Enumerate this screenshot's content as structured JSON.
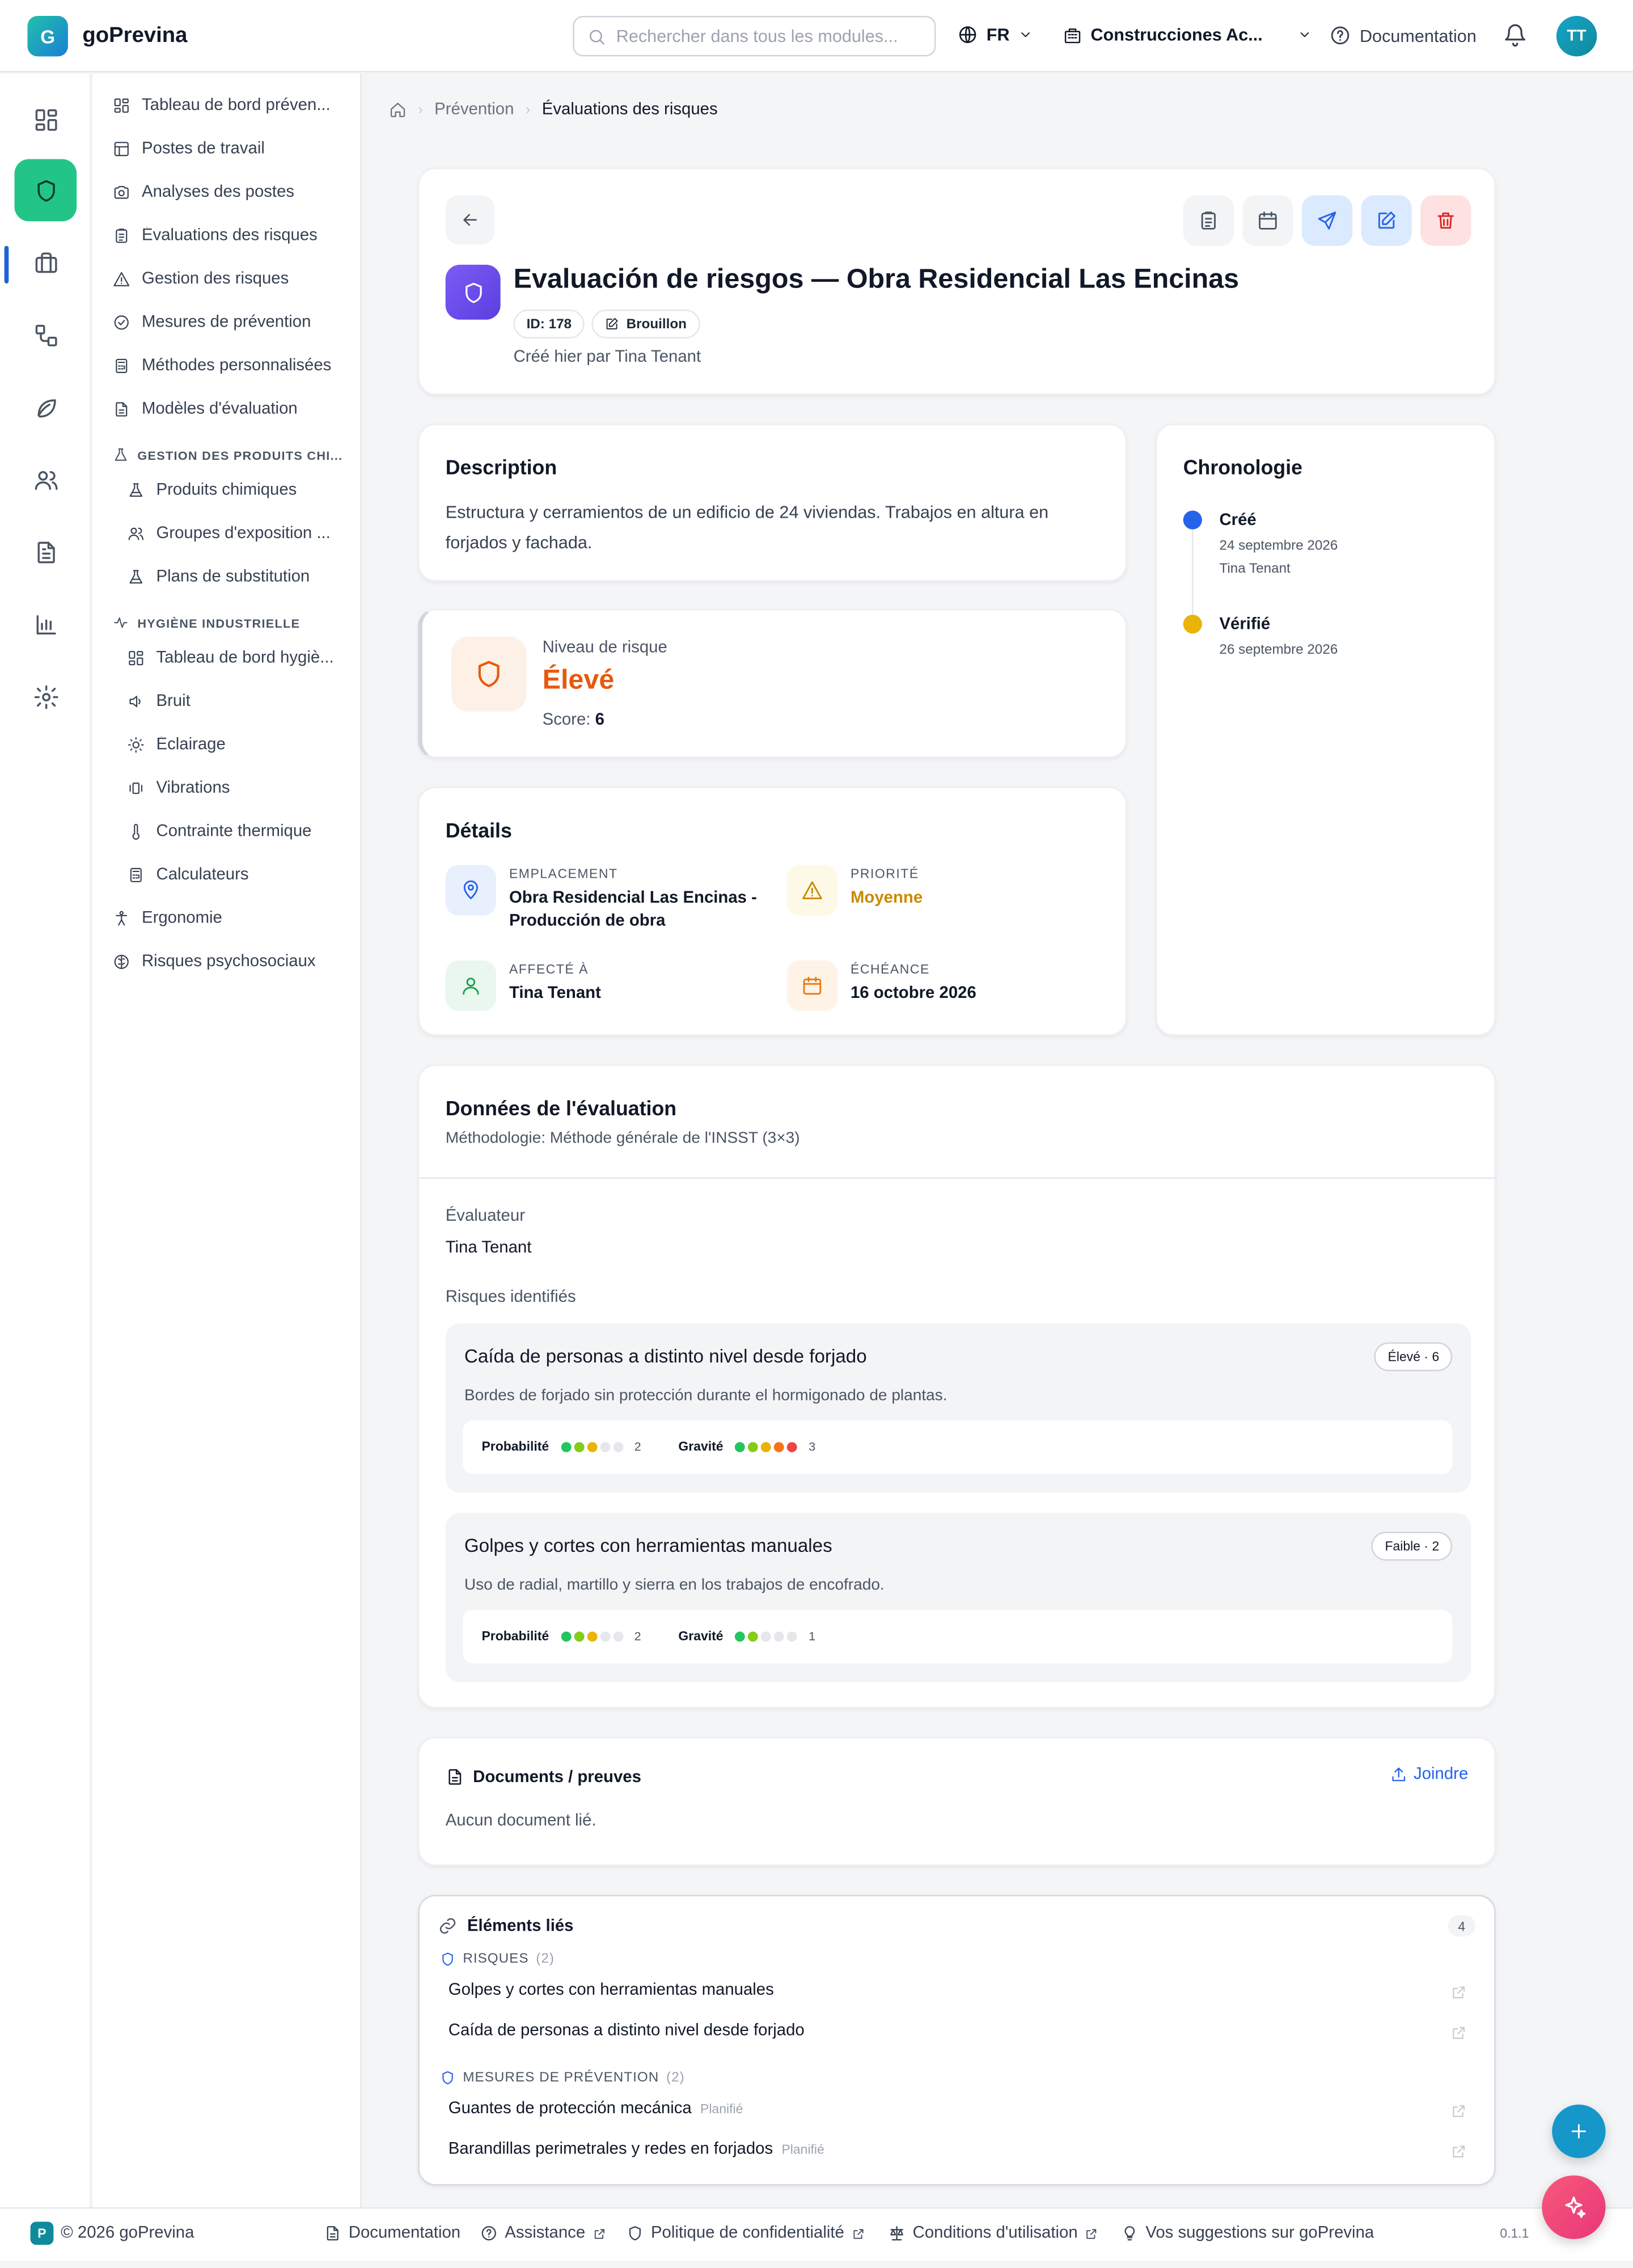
{
  "app": {
    "logo_letter": "G",
    "name": "goPrevina"
  },
  "header": {
    "search_placeholder": "Rechercher dans tous les modules...",
    "language": "FR",
    "company": "Construcciones Ac...",
    "docs_label": "Documentation",
    "user_initials": "TT"
  },
  "rail": {
    "icons": [
      "dashboard-icon",
      "shield-icon",
      "briefcase-icon",
      "workflow-icon",
      "leaf-icon",
      "users-icon",
      "file-text-icon",
      "bar-chart-icon",
      "settings-icon"
    ],
    "active": "shield-icon"
  },
  "sidebar": {
    "items": [
      {
        "label": "Tableau de bord préven...",
        "icon": "dashboard-icon"
      },
      {
        "label": "Postes de travail",
        "icon": "grid-icon"
      },
      {
        "label": "Analyses des postes",
        "icon": "camera-icon"
      },
      {
        "label": "Évaluations des risques",
        "icon": "clipboard-icon"
      },
      {
        "label": "Gestion des risques",
        "icon": "warning-icon"
      },
      {
        "label": "Mesures de prévention",
        "icon": "check-circle-icon"
      },
      {
        "label": "Méthodes personnalisées",
        "icon": "calculator-icon"
      },
      {
        "label": "Modèles d'évaluation",
        "icon": "file-icon"
      }
    ],
    "section_chem": "GESTION DES PRODUITS CHI...",
    "chem_items": [
      {
        "label": "Produits chimiques",
        "icon": "flask-icon"
      },
      {
        "label": "Groupes d'exposition ...",
        "icon": "users-icon"
      },
      {
        "label": "Plans de substitution",
        "icon": "flask-icon"
      }
    ],
    "section_hyg": "HYGIÈNE INDUSTRIELLE",
    "hyg_items": [
      {
        "label": "Tableau de bord hygiè...",
        "icon": "dashboard-icon"
      },
      {
        "label": "Bruit",
        "icon": "speaker-icon"
      },
      {
        "label": "Éclairage",
        "icon": "sun-icon"
      },
      {
        "label": "Vibrations",
        "icon": "vibration-icon"
      },
      {
        "label": "Contrainte thermique",
        "icon": "thermometer-icon"
      },
      {
        "label": "Calculateurs",
        "icon": "calculator-icon"
      }
    ],
    "bottom_items": [
      {
        "label": "Ergonomie",
        "icon": "person-icon"
      },
      {
        "label": "Risques psychosociaux",
        "icon": "brain-icon"
      }
    ]
  },
  "breadcrumb": {
    "home": "home-icon",
    "parent": "Prévention",
    "current": "Évaluations des risques"
  },
  "assessment": {
    "title": "Evaluación de riesgos — Obra Residencial Las Encinas",
    "id": "ID: 178",
    "status": "Brouillon",
    "created": "Créé hier par Tina Tenant"
  },
  "description": {
    "heading": "Description",
    "text": "Estructura y cerramientos de un edificio de 24 viviendas. Trabajos en altura en forjados y fachada."
  },
  "risk_level": {
    "label": "Niveau de risque",
    "value": "Élevé",
    "score_label": "Score:",
    "score": "6",
    "color": "#e8590c"
  },
  "details": {
    "heading": "Détails",
    "location_label": "EMPLACEMENT",
    "location": "Obra Residencial Las Encinas - Producción de obra",
    "priority_label": "PRIORITÉ",
    "priority": "Moyenne",
    "assigned_label": "AFFECTÉ À",
    "assigned": "Tina Tenant",
    "due_label": "ÉCHÉANCE",
    "due": "16 octobre 2026"
  },
  "timeline": {
    "heading": "Chronologie",
    "events": [
      {
        "title": "Créé",
        "date": "24 septembre 2026",
        "by": "Tina Tenant",
        "color": "#2563eb"
      },
      {
        "title": "Vérifié",
        "date": "26 septembre 2026",
        "color": "#eab308"
      }
    ]
  },
  "evaluation": {
    "heading": "Données de l'évaluation",
    "method": "Méthodologie: Méthode générale de l'INSST (3×3)",
    "evaluator_label": "Évaluateur",
    "evaluator": "Tina Tenant",
    "risks_label": "Risques identifiés",
    "prob_label": "Probabilité",
    "sev_label": "Gravité",
    "risks": [
      {
        "name": "Caída de personas a distinto nivel desde forjado",
        "badge": "Élevé · 6",
        "desc": "Bordes de forjado sin protección durante el hormigonado de plantas.",
        "probability": 2,
        "severity": 3
      },
      {
        "name": "Golpes y cortes con herramientas manuales",
        "badge": "Faible · 2",
        "desc": "Uso de radial, martillo y sierra en los trabajos de encofrado.",
        "probability": 2,
        "severity": 1
      }
    ]
  },
  "documents": {
    "heading": "Documents / preuves",
    "attach": "Joindre",
    "empty": "Aucun document lié."
  },
  "linked": {
    "heading": "Éléments liés",
    "count": "4",
    "risks_label": "RISQUES",
    "risks_count": "(2)",
    "risks": [
      "Golpes y cortes con herramientas manuales",
      "Caída de personas a distinto nivel desde forjado"
    ],
    "measures_label": "MESURES DE PRÉVENTION",
    "measures_count": "(2)",
    "measures": [
      {
        "name": "Guantes de protección mecánica",
        "status": "Planifié"
      },
      {
        "name": "Barandillas perimetrales y redes en forjados",
        "status": "Planifié"
      }
    ]
  },
  "footer": {
    "badge": "P",
    "copyright": "© 2026 goPrevina",
    "documentation": "Documentation",
    "support": "Assistance",
    "privacy": "Politique de confidentialité",
    "terms": "Conditions d'utilisation",
    "feedback": "Vos suggestions sur goPrevina",
    "version": "0.1.1"
  }
}
